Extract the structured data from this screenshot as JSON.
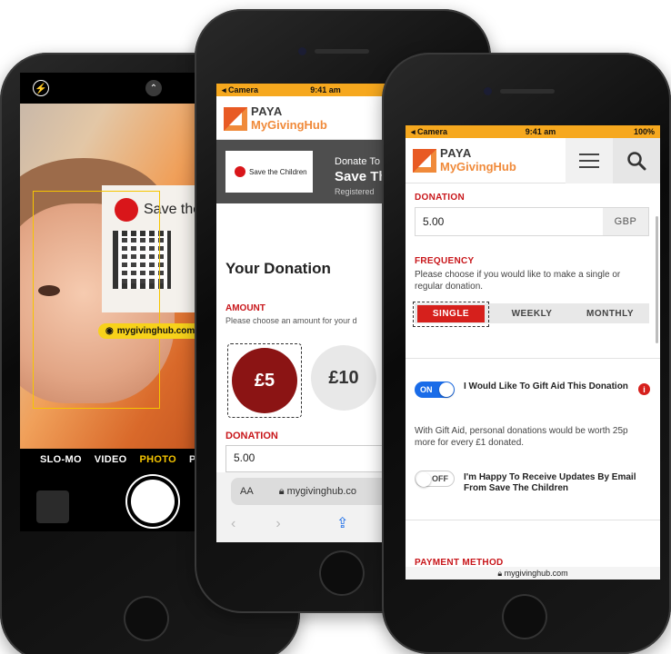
{
  "phone1": {
    "modes": [
      "SLO-MO",
      "VIDEO",
      "PHOTO",
      "PO"
    ],
    "active_mode": "PHOTO",
    "poster_text": "Save the",
    "scan_url": "mygivinghub.com",
    "icons": [
      "flash-icon",
      "chevron-up-icon",
      "shutter-button"
    ]
  },
  "phone2": {
    "status": {
      "carrier": "◂ Camera",
      "time": "9:41 am"
    },
    "logo": {
      "line1": "PAYA",
      "line2": "MyGivingHub"
    },
    "charity_card": "Save the Children",
    "band": {
      "line1": "Donate To",
      "line2": "Save Th",
      "line3": "Registered"
    },
    "title": "Your Donation",
    "amount_label": "AMOUNT",
    "amount_sub": "Please choose an amount for your d",
    "amount_5": "£5",
    "amount_10": "£10",
    "donation_label": "DONATION",
    "donation_value": "5.00",
    "text_size": "AA",
    "url": "mygivinghub.co"
  },
  "phone3": {
    "status": {
      "carrier": "◂ Camera",
      "time": "9:41 am",
      "battery": "100%"
    },
    "logo": {
      "line1": "PAYA",
      "line2": "MyGivingHub"
    },
    "donation_label": "DONATION",
    "donation_value": "5.00",
    "currency": "GBP",
    "frequency_label": "FREQUENCY",
    "frequency_sub": "Please choose if you would like to make a single or regular donation.",
    "frequency_options": [
      "SINGLE",
      "WEEKLY",
      "MONTHLY"
    ],
    "gift_aid_toggle": "ON",
    "gift_aid_label": "I Would Like To Gift Aid This Donation",
    "gift_aid_note": "With Gift Aid, personal donations would be worth 25p more for every £1 donated.",
    "updates_toggle": "OFF",
    "updates_label": "I'm Happy To Receive Updates By Email From Save The Children",
    "payment_label": "PAYMENT METHOD",
    "url": "mygivinghub.com"
  },
  "colors": {
    "accent_red": "#d6201c",
    "brand_orange": "#f08a3a",
    "status_orange": "#f6a81e",
    "ios_blue": "#1a6ce8"
  }
}
